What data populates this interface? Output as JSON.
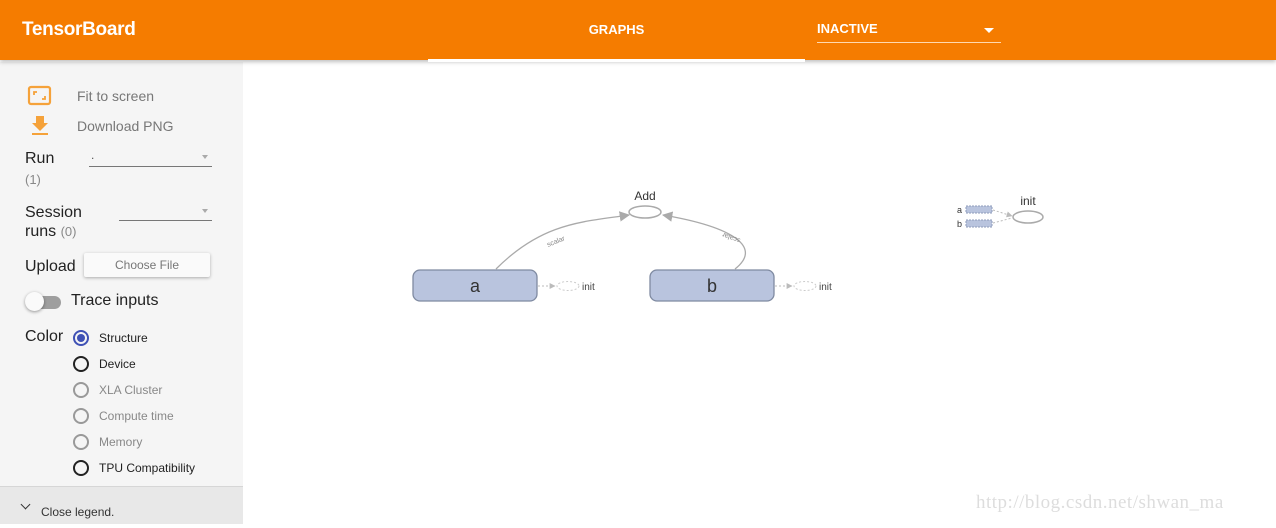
{
  "app": {
    "title": "TensorBoard",
    "brand_color": "#f57c00"
  },
  "header": {
    "tabs": [
      {
        "label": "GRAPHS",
        "active": true
      }
    ],
    "inactive_dropdown": {
      "selected": "INACTIVE",
      "icon": "dropdown-caret-icon"
    }
  },
  "sidebar": {
    "actions": [
      {
        "label": "Fit to screen",
        "icon": "fit-to-screen-icon"
      },
      {
        "label": "Download PNG",
        "icon": "download-icon"
      }
    ],
    "run": {
      "label": "Run",
      "count": "(1)",
      "selected": "."
    },
    "session_runs": {
      "label_line1": "Session",
      "label_line2": "runs",
      "count": "(0)",
      "selected": ""
    },
    "upload": {
      "label": "Upload",
      "button_label": "Choose File"
    },
    "trace_inputs": {
      "label": "Trace inputs",
      "enabled": false
    },
    "color": {
      "label": "Color",
      "options": [
        {
          "label": "Structure",
          "checked": true,
          "disabled": false
        },
        {
          "label": "Device",
          "checked": false,
          "disabled": false
        },
        {
          "label": "XLA Cluster",
          "checked": false,
          "disabled": true
        },
        {
          "label": "Compute time",
          "checked": false,
          "disabled": true
        },
        {
          "label": "Memory",
          "checked": false,
          "disabled": true
        },
        {
          "label": "TPU Compatibility",
          "checked": false,
          "disabled": false
        }
      ]
    },
    "legend_toggle": {
      "label": "Close legend."
    }
  },
  "graph": {
    "nodes": [
      {
        "id": "a",
        "label": "a",
        "type": "variable"
      },
      {
        "id": "b",
        "label": "b",
        "type": "variable"
      },
      {
        "id": "add",
        "label": "Add",
        "type": "op"
      },
      {
        "id": "init",
        "label": "init",
        "type": "op"
      }
    ],
    "edges": [
      {
        "from": "a",
        "to": "Add",
        "label": "scalar"
      },
      {
        "from": "b",
        "to": "Add",
        "label": "scalar"
      }
    ],
    "control_deps": [
      {
        "from": "a",
        "to": "init",
        "label": "init"
      },
      {
        "from": "b",
        "to": "init",
        "label": "init"
      }
    ],
    "aux_labels": [
      "a",
      "b"
    ],
    "node_fill": "#b9c4de",
    "node_stroke": "#7f8aa1"
  },
  "watermark": "http://blog.csdn.net/shwan_ma"
}
